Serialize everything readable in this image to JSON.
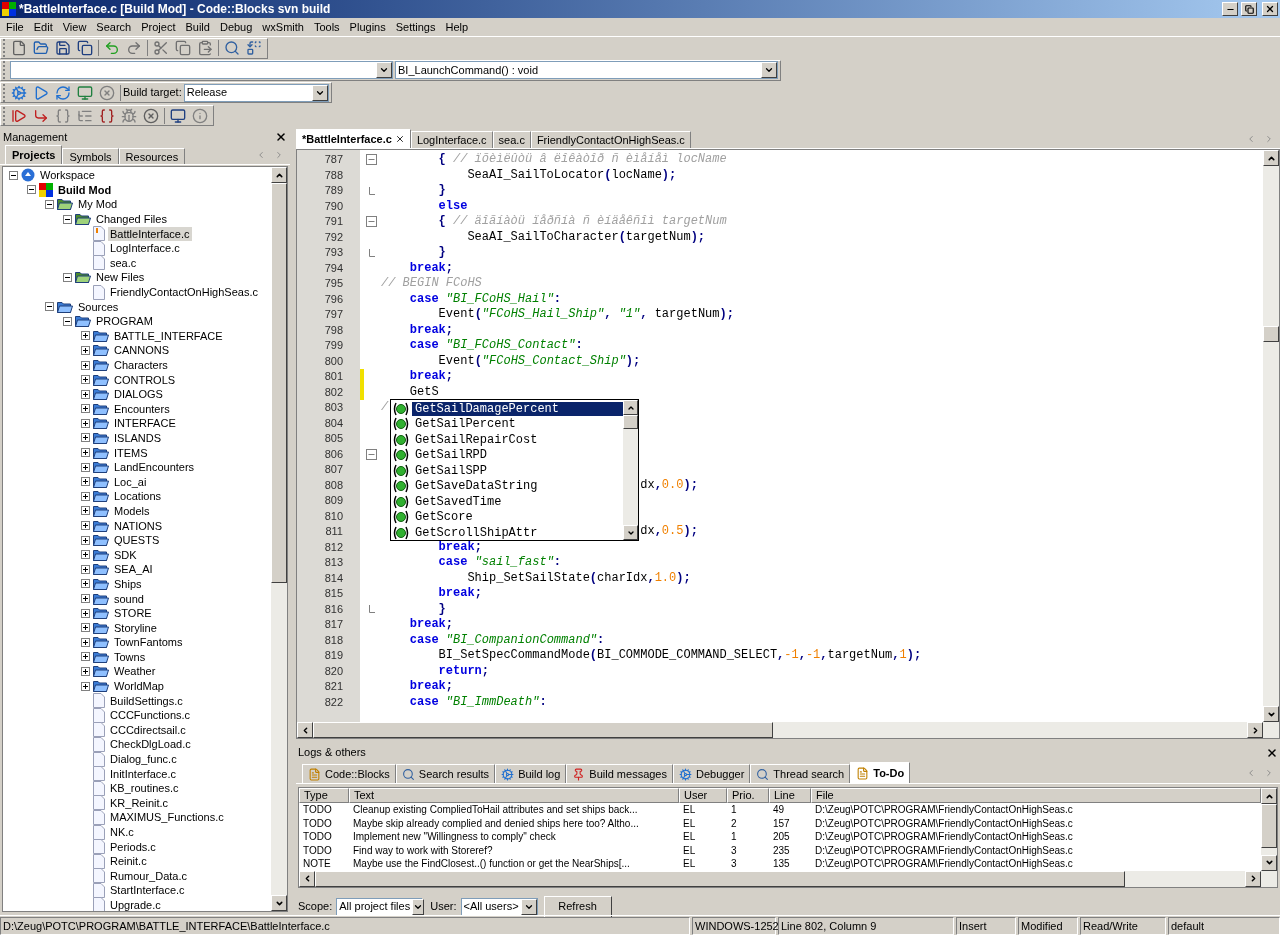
{
  "window": {
    "title": "*BattleInterface.c [Build Mod] - Code::Blocks svn build"
  },
  "menu": [
    "File",
    "Edit",
    "View",
    "Search",
    "Project",
    "Build",
    "Debug",
    "wxSmith",
    "Tools",
    "Plugins",
    "Settings",
    "Help"
  ],
  "function_combo": {
    "value": "BI_LaunchCommand() : void"
  },
  "build_target": {
    "label": "Build target:",
    "value": "Release"
  },
  "management": {
    "title": "Management",
    "tabs": [
      {
        "label": "Projects",
        "selected": true
      },
      {
        "label": "Symbols",
        "selected": false
      },
      {
        "label": "Resources",
        "selected": false
      }
    ],
    "tree": [
      {
        "label": "Workspace",
        "kind": "workspace",
        "expanded": true,
        "selected": false,
        "children": [
          {
            "label": "Build Mod",
            "kind": "project",
            "expanded": true,
            "selected": false,
            "children": [
              {
                "label": "My Mod",
                "kind": "virtual_folder",
                "expanded": true,
                "selected": false,
                "children": [
                  {
                    "label": "Changed Files",
                    "kind": "virtual_folder",
                    "expanded": true,
                    "selected": false,
                    "children": [
                      {
                        "label": "BattleInterface.c",
                        "kind": "file",
                        "selected": true,
                        "modified": true
                      },
                      {
                        "label": "LogInterface.c",
                        "kind": "file",
                        "selected": false,
                        "modified": false
                      },
                      {
                        "label": "sea.c",
                        "kind": "file",
                        "selected": false,
                        "modified": false
                      }
                    ]
                  },
                  {
                    "label": "New Files",
                    "kind": "virtual_folder",
                    "expanded": true,
                    "selected": false,
                    "children": [
                      {
                        "label": "FriendlyContactOnHighSeas.c",
                        "kind": "file",
                        "selected": false,
                        "modified": false
                      }
                    ]
                  }
                ]
              },
              {
                "label": "Sources",
                "kind": "folder",
                "expanded": true,
                "selected": false,
                "children": [
                  {
                    "label": "PROGRAM",
                    "kind": "folder",
                    "expanded": true,
                    "selected": false,
                    "children": [
                      {
                        "label": "BATTLE_INTERFACE",
                        "kind": "folder",
                        "expanded": false,
                        "selected": false
                      },
                      {
                        "label": "CANNONS",
                        "kind": "folder",
                        "expanded": false,
                        "selected": false
                      },
                      {
                        "label": "Characters",
                        "kind": "folder",
                        "expanded": false,
                        "selected": false
                      },
                      {
                        "label": "CONTROLS",
                        "kind": "folder",
                        "expanded": false,
                        "selected": false
                      },
                      {
                        "label": "DIALOGS",
                        "kind": "folder",
                        "expanded": false,
                        "selected": false
                      },
                      {
                        "label": "Encounters",
                        "kind": "folder",
                        "expanded": false,
                        "selected": false
                      },
                      {
                        "label": "INTERFACE",
                        "kind": "folder",
                        "expanded": false,
                        "selected": false
                      },
                      {
                        "label": "ISLANDS",
                        "kind": "folder",
                        "expanded": false,
                        "selected": false
                      },
                      {
                        "label": "ITEMS",
                        "kind": "folder",
                        "expanded": false,
                        "selected": false
                      },
                      {
                        "label": "LandEncounters",
                        "kind": "folder",
                        "expanded": false,
                        "selected": false
                      },
                      {
                        "label": "Loc_ai",
                        "kind": "folder",
                        "expanded": false,
                        "selected": false
                      },
                      {
                        "label": "Locations",
                        "kind": "folder",
                        "expanded": false,
                        "selected": false
                      },
                      {
                        "label": "Models",
                        "kind": "folder",
                        "expanded": false,
                        "selected": false
                      },
                      {
                        "label": "NATIONS",
                        "kind": "folder",
                        "expanded": false,
                        "selected": false
                      },
                      {
                        "label": "QUESTS",
                        "kind": "folder",
                        "expanded": false,
                        "selected": false
                      },
                      {
                        "label": "SDK",
                        "kind": "folder",
                        "expanded": false,
                        "selected": false
                      },
                      {
                        "label": "SEA_AI",
                        "kind": "folder",
                        "expanded": false,
                        "selected": false
                      },
                      {
                        "label": "Ships",
                        "kind": "folder",
                        "expanded": false,
                        "selected": false
                      },
                      {
                        "label": "sound",
                        "kind": "folder",
                        "expanded": false,
                        "selected": false
                      },
                      {
                        "label": "STORE",
                        "kind": "folder",
                        "expanded": false,
                        "selected": false
                      },
                      {
                        "label": "Storyline",
                        "kind": "folder",
                        "expanded": false,
                        "selected": false
                      },
                      {
                        "label": "TownFantoms",
                        "kind": "folder",
                        "expanded": false,
                        "selected": false
                      },
                      {
                        "label": "Towns",
                        "kind": "folder",
                        "expanded": false,
                        "selected": false
                      },
                      {
                        "label": "Weather",
                        "kind": "folder",
                        "expanded": false,
                        "selected": false
                      },
                      {
                        "label": "WorldMap",
                        "kind": "folder",
                        "expanded": false,
                        "selected": false
                      },
                      {
                        "label": "BuildSettings.c",
                        "kind": "file",
                        "selected": false,
                        "modified": false
                      },
                      {
                        "label": "CCCFunctions.c",
                        "kind": "file",
                        "selected": false,
                        "modified": false
                      },
                      {
                        "label": "CCCdirectsail.c",
                        "kind": "file",
                        "selected": false,
                        "modified": false
                      },
                      {
                        "label": "CheckDlgLoad.c",
                        "kind": "file",
                        "selected": false,
                        "modified": false
                      },
                      {
                        "label": "Dialog_func.c",
                        "kind": "file",
                        "selected": false,
                        "modified": false
                      },
                      {
                        "label": "InitInterface.c",
                        "kind": "file",
                        "selected": false,
                        "modified": false
                      },
                      {
                        "label": "KB_routines.c",
                        "kind": "file",
                        "selected": false,
                        "modified": false
                      },
                      {
                        "label": "KR_Reinit.c",
                        "kind": "file",
                        "selected": false,
                        "modified": false
                      },
                      {
                        "label": "MAXIMUS_Functions.c",
                        "kind": "file",
                        "selected": false,
                        "modified": false
                      },
                      {
                        "label": "NK.c",
                        "kind": "file",
                        "selected": false,
                        "modified": false
                      },
                      {
                        "label": "Periods.c",
                        "kind": "file",
                        "selected": false,
                        "modified": false
                      },
                      {
                        "label": "Reinit.c",
                        "kind": "file",
                        "selected": false,
                        "modified": false
                      },
                      {
                        "label": "Rumour_Data.c",
                        "kind": "file",
                        "selected": false,
                        "modified": false
                      },
                      {
                        "label": "StartInterface.c",
                        "kind": "file",
                        "selected": false,
                        "modified": false
                      },
                      {
                        "label": "Upgrade.c",
                        "kind": "file",
                        "selected": false,
                        "modified": false
                      }
                    ]
                  }
                ]
              }
            ]
          }
        ]
      }
    ]
  },
  "editor": {
    "tabs": [
      {
        "label": "*BattleInterface.c",
        "selected": true,
        "closable": true
      },
      {
        "label": "LogInterface.c",
        "selected": false,
        "closable": false
      },
      {
        "label": "sea.c",
        "selected": false,
        "closable": false
      },
      {
        "label": "FriendlyContactOnHighSeas.c",
        "selected": false,
        "closable": false
      }
    ],
    "lines": [
      {
        "n": "787",
        "kind": "fold_start",
        "changed": false,
        "tokens": [
          {
            "kind": "op",
            "text": "        {"
          },
          {
            "kind": "cmt",
            "text": " // ïõèìëûòü â ëîêàòîð ñ èìåíåì locName"
          }
        ]
      },
      {
        "n": "788",
        "kind": "plain",
        "changed": false,
        "tokens": [
          {
            "kind": "plain",
            "text": "            SeaAI_SailToLocator"
          },
          {
            "kind": "op",
            "text": "("
          },
          {
            "kind": "plain",
            "text": "locName"
          },
          {
            "kind": "op",
            "text": ");"
          }
        ]
      },
      {
        "n": "789",
        "kind": "fold_end",
        "changed": false,
        "tokens": [
          {
            "kind": "op",
            "text": "        }"
          }
        ]
      },
      {
        "n": "790",
        "kind": "plain",
        "changed": false,
        "tokens": [
          {
            "kind": "kw",
            "text": "        else"
          }
        ]
      },
      {
        "n": "791",
        "kind": "fold_start",
        "changed": false,
        "tokens": [
          {
            "kind": "op",
            "text": "        {"
          },
          {
            "kind": "cmt",
            "text": " // äîãíàòü ïåðñíà ñ èíäåêñîì targetNum"
          }
        ]
      },
      {
        "n": "792",
        "kind": "plain",
        "changed": false,
        "tokens": [
          {
            "kind": "plain",
            "text": "            SeaAI_SailToCharacter"
          },
          {
            "kind": "op",
            "text": "("
          },
          {
            "kind": "plain",
            "text": "targetNum"
          },
          {
            "kind": "op",
            "text": ");"
          }
        ]
      },
      {
        "n": "793",
        "kind": "fold_end",
        "changed": false,
        "tokens": [
          {
            "kind": "op",
            "text": "        }"
          }
        ]
      },
      {
        "n": "794",
        "kind": "plain",
        "changed": false,
        "tokens": [
          {
            "kind": "kw",
            "text": "    break"
          },
          {
            "kind": "op",
            "text": ";"
          }
        ]
      },
      {
        "n": "795",
        "kind": "plain",
        "changed": false,
        "tokens": [
          {
            "kind": "cmt",
            "text": "// BEGIN FCoHS"
          }
        ]
      },
      {
        "n": "796",
        "kind": "plain",
        "changed": false,
        "tokens": [
          {
            "kind": "kw",
            "text": "    case "
          },
          {
            "kind": "str",
            "text": "\"BI_FCoHS_Hail\""
          },
          {
            "kind": "op",
            "text": ":"
          }
        ]
      },
      {
        "n": "797",
        "kind": "plain",
        "changed": false,
        "tokens": [
          {
            "kind": "plain",
            "text": "        Event"
          },
          {
            "kind": "op",
            "text": "("
          },
          {
            "kind": "str",
            "text": "\"FCoHS_Hail_Ship\""
          },
          {
            "kind": "op",
            "text": ", "
          },
          {
            "kind": "str",
            "text": "\"1\""
          },
          {
            "kind": "op",
            "text": ", "
          },
          {
            "kind": "plain",
            "text": "targetNum"
          },
          {
            "kind": "op",
            "text": ");"
          }
        ]
      },
      {
        "n": "798",
        "kind": "plain",
        "changed": false,
        "tokens": [
          {
            "kind": "kw",
            "text": "    break"
          },
          {
            "kind": "op",
            "text": ";"
          }
        ]
      },
      {
        "n": "799",
        "kind": "plain",
        "changed": false,
        "tokens": [
          {
            "kind": "kw",
            "text": "    case "
          },
          {
            "kind": "str",
            "text": "\"BI_FCoHS_Contact\""
          },
          {
            "kind": "op",
            "text": ":"
          }
        ]
      },
      {
        "n": "800",
        "kind": "plain",
        "changed": false,
        "tokens": [
          {
            "kind": "plain",
            "text": "        Event"
          },
          {
            "kind": "op",
            "text": "("
          },
          {
            "kind": "str",
            "text": "\"FCoHS_Contact_Ship\""
          },
          {
            "kind": "op",
            "text": ");"
          }
        ]
      },
      {
        "n": "801",
        "kind": "plain",
        "changed": true,
        "tokens": [
          {
            "kind": "kw",
            "text": "    break"
          },
          {
            "kind": "op",
            "text": ";"
          }
        ]
      },
      {
        "n": "802",
        "kind": "plain",
        "changed": true,
        "tokens": [
          {
            "kind": "plain",
            "text": "    GetS"
          }
        ]
      },
      {
        "n": "803",
        "kind": "plain",
        "changed": false,
        "tokens": [
          {
            "kind": "cmt",
            "text": "/"
          }
        ]
      },
      {
        "n": "804",
        "kind": "plain",
        "changed": false
      },
      {
        "n": "805",
        "kind": "plain",
        "changed": false
      },
      {
        "n": "806",
        "kind": "fold_start",
        "changed": false
      },
      {
        "n": "807",
        "kind": "plain",
        "changed": false
      },
      {
        "n": "808",
        "kind": "plain",
        "changed": false,
        "tokens": [
          {
            "kind": "plain",
            "text": "                                    dx"
          },
          {
            "kind": "op",
            "text": ","
          },
          {
            "kind": "num",
            "text": "0.0"
          },
          {
            "kind": "op",
            "text": ");"
          }
        ]
      },
      {
        "n": "809",
        "kind": "plain",
        "changed": false
      },
      {
        "n": "810",
        "kind": "plain",
        "changed": false
      },
      {
        "n": "811",
        "kind": "plain",
        "changed": false,
        "tokens": [
          {
            "kind": "plain",
            "text": "                                    dx"
          },
          {
            "kind": "op",
            "text": ","
          },
          {
            "kind": "num",
            "text": "0.5"
          },
          {
            "kind": "op",
            "text": ");"
          }
        ]
      },
      {
        "n": "812",
        "kind": "plain",
        "changed": false,
        "tokens": [
          {
            "kind": "kw",
            "text": "        break"
          },
          {
            "kind": "op",
            "text": ";"
          }
        ]
      },
      {
        "n": "813",
        "kind": "plain",
        "changed": false,
        "tokens": [
          {
            "kind": "kw",
            "text": "        case "
          },
          {
            "kind": "str",
            "text": "\"sail_fast\""
          },
          {
            "kind": "op",
            "text": ":"
          }
        ]
      },
      {
        "n": "814",
        "kind": "plain",
        "changed": false,
        "tokens": [
          {
            "kind": "plain",
            "text": "            Ship_SetSailState"
          },
          {
            "kind": "op",
            "text": "("
          },
          {
            "kind": "plain",
            "text": "charIdx"
          },
          {
            "kind": "op",
            "text": ","
          },
          {
            "kind": "num",
            "text": "1.0"
          },
          {
            "kind": "op",
            "text": ");"
          }
        ]
      },
      {
        "n": "815",
        "kind": "plain",
        "changed": false,
        "tokens": [
          {
            "kind": "kw",
            "text": "        break"
          },
          {
            "kind": "op",
            "text": ";"
          }
        ]
      },
      {
        "n": "816",
        "kind": "fold_end",
        "changed": false,
        "tokens": [
          {
            "kind": "op",
            "text": "        }"
          }
        ]
      },
      {
        "n": "817",
        "kind": "plain",
        "changed": false,
        "tokens": [
          {
            "kind": "kw",
            "text": "    break"
          },
          {
            "kind": "op",
            "text": ";"
          }
        ]
      },
      {
        "n": "818",
        "kind": "plain",
        "changed": false,
        "tokens": [
          {
            "kind": "kw",
            "text": "    case "
          },
          {
            "kind": "str",
            "text": "\"BI_CompanionCommand\""
          },
          {
            "kind": "op",
            "text": ":"
          }
        ]
      },
      {
        "n": "819",
        "kind": "plain",
        "changed": false,
        "tokens": [
          {
            "kind": "plain",
            "text": "        BI_SetSpecCommandMode"
          },
          {
            "kind": "op",
            "text": "("
          },
          {
            "kind": "plain",
            "text": "BI_COMMODE_COMMAND_SELECT"
          },
          {
            "kind": "op",
            "text": ","
          },
          {
            "kind": "num",
            "text": "-1"
          },
          {
            "kind": "op",
            "text": ","
          },
          {
            "kind": "num",
            "text": "-1"
          },
          {
            "kind": "op",
            "text": ","
          },
          {
            "kind": "plain",
            "text": "targetNum"
          },
          {
            "kind": "op",
            "text": ","
          },
          {
            "kind": "num",
            "text": "1"
          },
          {
            "kind": "op",
            "text": ");"
          }
        ]
      },
      {
        "n": "820",
        "kind": "plain",
        "changed": false,
        "tokens": [
          {
            "kind": "kw",
            "text": "        return"
          },
          {
            "kind": "op",
            "text": ";"
          }
        ]
      },
      {
        "n": "821",
        "kind": "plain",
        "changed": false,
        "tokens": [
          {
            "kind": "kw",
            "text": "    break"
          },
          {
            "kind": "op",
            "text": ";"
          }
        ]
      },
      {
        "n": "822",
        "kind": "plain",
        "changed": false,
        "tokens": [
          {
            "kind": "kw",
            "text": "    case "
          },
          {
            "kind": "str",
            "text": "\"BI_ImmDeath\""
          },
          {
            "kind": "op",
            "text": ":"
          }
        ]
      }
    ],
    "autocomplete": [
      {
        "label": "GetSailDamagePercent",
        "selected": true
      },
      {
        "label": "GetSailPercent",
        "selected": false
      },
      {
        "label": "GetSailRepairCost",
        "selected": false
      },
      {
        "label": "GetSailRPD",
        "selected": false
      },
      {
        "label": "GetSailSPP",
        "selected": false
      },
      {
        "label": "GetSaveDataString",
        "selected": false
      },
      {
        "label": "GetSavedTime",
        "selected": false
      },
      {
        "label": "GetScore",
        "selected": false
      },
      {
        "label": "GetScrollShipAttr",
        "selected": false
      }
    ]
  },
  "logs": {
    "title": "Logs & others",
    "tabs": [
      {
        "label": "Code::Blocks",
        "selected": false
      },
      {
        "label": "Search results",
        "selected": false
      },
      {
        "label": "Build log",
        "selected": false
      },
      {
        "label": "Build messages",
        "selected": false
      },
      {
        "label": "Debugger",
        "selected": false
      },
      {
        "label": "Thread search",
        "selected": false
      },
      {
        "label": "To-Do",
        "selected": true
      }
    ],
    "columns": [
      "Type",
      "Text",
      "User",
      "Prio.",
      "Line",
      "File"
    ],
    "rows": [
      [
        "TODO",
        "Cleanup existing CompliedToHail attributes and set ships back...",
        "EL",
        "1",
        "49",
        "D:\\Zeug\\POTC\\PROGRAM\\FriendlyContactOnHighSeas.c"
      ],
      [
        "TODO",
        "Maybe skip already complied and denied ships here too? Altho...",
        "EL",
        "2",
        "157",
        "D:\\Zeug\\POTC\\PROGRAM\\FriendlyContactOnHighSeas.c"
      ],
      [
        "TODO",
        "Implement new \"Willingness to comply\" check",
        "EL",
        "1",
        "205",
        "D:\\Zeug\\POTC\\PROGRAM\\FriendlyContactOnHighSeas.c"
      ],
      [
        "TODO",
        "Find way to work with Storeref?",
        "EL",
        "3",
        "235",
        "D:\\Zeug\\POTC\\PROGRAM\\FriendlyContactOnHighSeas.c"
      ],
      [
        "NOTE",
        "Maybe use the FindClosest..() function or get the NearShips[...",
        "EL",
        "3",
        "135",
        "D:\\Zeug\\POTC\\PROGRAM\\FriendlyContactOnHighSeas.c"
      ]
    ],
    "scope": {
      "label": "Scope:",
      "value": "All project files"
    },
    "user": {
      "label": "User:",
      "value": "<All users>"
    },
    "refresh": "Refresh"
  },
  "status_bar": [
    "D:\\Zeug\\POTC\\PROGRAM\\BATTLE_INTERFACE\\BattleInterface.c",
    "WINDOWS-1252",
    "Line 802, Column 9",
    "Insert",
    "Modified",
    "Read/Write",
    "default"
  ]
}
